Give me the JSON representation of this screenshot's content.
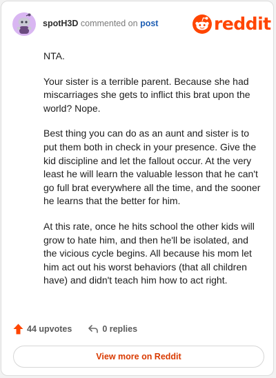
{
  "header": {
    "username": "spotH3D",
    "action_text": "commented on",
    "post_link": "post"
  },
  "brand": {
    "logo_text": "reddit",
    "accent_color": "#ff4500",
    "icon": "reddit-snoo-icon"
  },
  "comment": {
    "paragraphs": [
      "NTA.",
      "Your sister is a terrible parent. Because she had miscarriages she gets to inflict this brat upon the world? Nope.",
      "Best thing you can do as an aunt and sister is to put them both in check in your presence. Give the kid discipline and let the fallout occur. At the very least he will learn the valuable lesson that he can't go full brat everywhere all the time, and the sooner he learns that the better for him.",
      "At this rate, once he hits school the other kids will grow to hate him, and then he'll be isolated, and the vicious cycle begins. All because his mom let him act out his worst behaviors (that all children have) and didn't teach him how to act right."
    ]
  },
  "footer": {
    "upvotes": "44 upvotes",
    "replies": "0 replies",
    "upvote_icon": "upvote-arrow-icon",
    "reply_icon": "reply-arrow-icon"
  },
  "actions": {
    "view_more": "View more on Reddit"
  }
}
